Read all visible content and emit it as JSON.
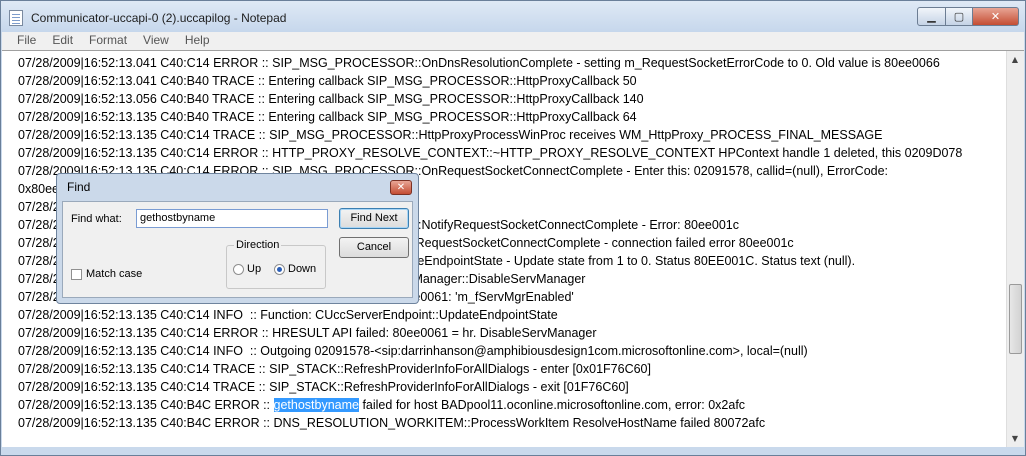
{
  "window": {
    "title": "Communicator-uccapi-0 (2).uccapilog - Notepad",
    "min_glyph": "▁",
    "max_glyph": "▢",
    "close_glyph": "✕"
  },
  "menu": [
    "File",
    "Edit",
    "Format",
    "View",
    "Help"
  ],
  "log": {
    "lines": [
      "07/28/2009|16:52:13.041 C40:C14 ERROR :: SIP_MSG_PROCESSOR::OnDnsResolutionComplete - setting m_RequestSocketErrorCode to 0. Old value is 80ee0066",
      "07/28/2009|16:52:13.041 C40:B40 TRACE :: Entering callback SIP_MSG_PROCESSOR::HttpProxyCallback 50",
      "07/28/2009|16:52:13.056 C40:B40 TRACE :: Entering callback SIP_MSG_PROCESSOR::HttpProxyCallback 140",
      "07/28/2009|16:52:13.135 C40:B40 TRACE :: Entering callback SIP_MSG_PROCESSOR::HttpProxyCallback 64",
      "07/28/2009|16:52:13.135 C40:C14 TRACE :: SIP_MSG_PROCESSOR::HttpProxyProcessWinProc receives WM_HttpProxy_PROCESS_FINAL_MESSAGE",
      "07/28/2009|16:52:13.135 C40:C14 ERROR :: HTTP_PROXY_RESOLVE_CONTEXT::~HTTP_PROXY_RESOLVE_CONTEXT HPContext handle 1 deleted, this 0209D078",
      "07/28/2009|16:52:13.135 C40:C14 ERROR :: SIP_MSG_PROCESSOR::OnRequestSocketConnectComplete - Enter this: 02091578, callid=(null), ErrorCode:",
      "0x80ee001c",
      "07/28/2009|16:52:13.135 C40:C14 TRACE :: Notifying transactions",
      "07/28/2009|16:52:13.135 C40:C14 ERROR :: SIP_MSG_PROCESSOR::NotifyRequestSocketConnectComplete - Error: 80ee001c",
      "07/28/2009|16:52:13.135 C40:C14 ERROR :: SIP_REGISTRATION::OnRequestSocketConnectComplete - connection failed error 80ee001c",
      "07/28/2009|16:52:13.135 C40:C14 INFO  :: CUccServerEndpoint::UpdateEndpointState - Update state from 1 to 0. Status 80EE001C. Status text (null).",
      "07/28/2009|16:52:13.135 C40:C14 INFO  :: Function: CUccRegistrationManager::DisableServManager",
      "07/28/2009|16:52:13.135 C40:C14 ERROR :: HRESULT API failed: 80ee0061: 'm_fServMgrEnabled'",
      "07/28/2009|16:52:13.135 C40:C14 INFO  :: Function: CUccServerEndpoint::UpdateEndpointState",
      "07/28/2009|16:52:13.135 C40:C14 ERROR :: HRESULT API failed: 80ee0061 = hr. DisableServManager",
      "07/28/2009|16:52:13.135 C40:C14 INFO  :: Outgoing 02091578-<sip:darrinhanson@amphibiousdesign1com.microsoftonline.com>, local=(null)",
      "07/28/2009|16:52:13.135 C40:C14 TRACE :: SIP_STACK::RefreshProviderInfoForAllDialogs - enter [0x01F76C60]",
      "07/28/2009|16:52:13.135 C40:C14 TRACE :: SIP_STACK::RefreshProviderInfoForAllDialogs - exit [01F76C60]"
    ],
    "highlight_line": {
      "before": "07/28/2009|16:52:13.135 C40:B4C ERROR :: ",
      "match": "gethostbyname",
      "after": " failed for host BADpool11.oconline.microsoftonline.com, error: 0x2afc"
    },
    "last_line": "07/28/2009|16:52:13.135 C40:B4C ERROR :: DNS_RESOLUTION_WORKITEM::ProcessWorkItem ResolveHostName failed 80072afc"
  },
  "scrollbar": {
    "up_glyph": "▲",
    "down_glyph": "▼"
  },
  "find_dialog": {
    "title": "Find",
    "close_glyph": "✕",
    "find_what_label": "Find what:",
    "find_value": "gethostbyname",
    "find_next_label": "Find Next",
    "cancel_label": "Cancel",
    "direction_label": "Direction",
    "up_label": "Up",
    "down_label": "Down",
    "direction_selected": "Down",
    "match_case_label": "Match case",
    "match_case_checked": false
  }
}
